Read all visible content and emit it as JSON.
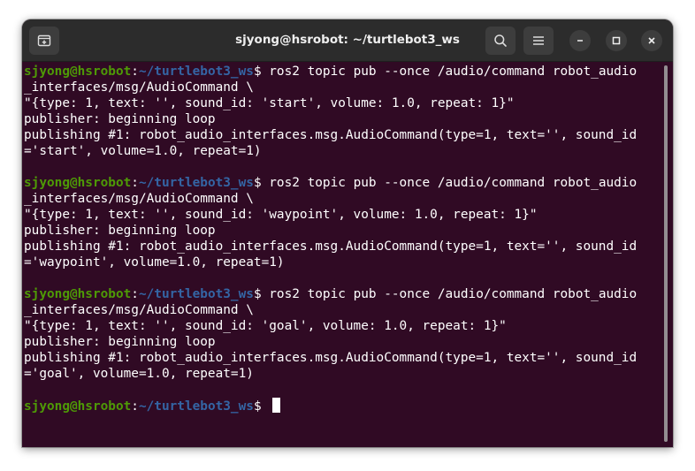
{
  "window": {
    "title": "sjyong@hsrobot: ~/turtlebot3_ws",
    "buttons": {
      "new_tab_icon": "new-tab-icon",
      "search_icon": "search-icon",
      "menu_icon": "hamburger-menu-icon",
      "minimize_icon": "minimize-icon",
      "maximize_icon": "maximize-icon",
      "close_icon": "close-icon"
    }
  },
  "colors": {
    "terminal_bg": "#300a24",
    "prompt_user": "#4e9a06",
    "prompt_path": "#3465a4",
    "text": "#ffffff"
  },
  "prompt": {
    "user_host": "sjyong@hsrobot",
    "separator": ":",
    "path": "~/turtlebot3_ws",
    "symbol": "$"
  },
  "terminal": {
    "lines": [
      {
        "type": "prompt",
        "command": " ros2 topic pub --once /audio/command robot_audio"
      },
      {
        "type": "output",
        "text": "_interfaces/msg/AudioCommand \\"
      },
      {
        "type": "output",
        "text": "\"{type: 1, text: '', sound_id: 'start', volume: 1.0, repeat: 1}\""
      },
      {
        "type": "output",
        "text": "publisher: beginning loop"
      },
      {
        "type": "output",
        "text": "publishing #1: robot_audio_interfaces.msg.AudioCommand(type=1, text='', sound_id"
      },
      {
        "type": "output",
        "text": "='start', volume=1.0, repeat=1)"
      },
      {
        "type": "output",
        "text": ""
      },
      {
        "type": "prompt",
        "command": " ros2 topic pub --once /audio/command robot_audio"
      },
      {
        "type": "output",
        "text": "_interfaces/msg/AudioCommand \\"
      },
      {
        "type": "output",
        "text": "\"{type: 1, text: '', sound_id: 'waypoint', volume: 1.0, repeat: 1}\""
      },
      {
        "type": "output",
        "text": "publisher: beginning loop"
      },
      {
        "type": "output",
        "text": "publishing #1: robot_audio_interfaces.msg.AudioCommand(type=1, text='', sound_id"
      },
      {
        "type": "output",
        "text": "='waypoint', volume=1.0, repeat=1)"
      },
      {
        "type": "output",
        "text": ""
      },
      {
        "type": "prompt",
        "command": " ros2 topic pub --once /audio/command robot_audio"
      },
      {
        "type": "output",
        "text": "_interfaces/msg/AudioCommand \\"
      },
      {
        "type": "output",
        "text": "\"{type: 1, text: '', sound_id: 'goal', volume: 1.0, repeat: 1}\""
      },
      {
        "type": "output",
        "text": "publisher: beginning loop"
      },
      {
        "type": "output",
        "text": "publishing #1: robot_audio_interfaces.msg.AudioCommand(type=1, text='', sound_id"
      },
      {
        "type": "output",
        "text": "='goal', volume=1.0, repeat=1)"
      },
      {
        "type": "output",
        "text": ""
      },
      {
        "type": "prompt",
        "command": " ",
        "cursor": true
      }
    ]
  }
}
